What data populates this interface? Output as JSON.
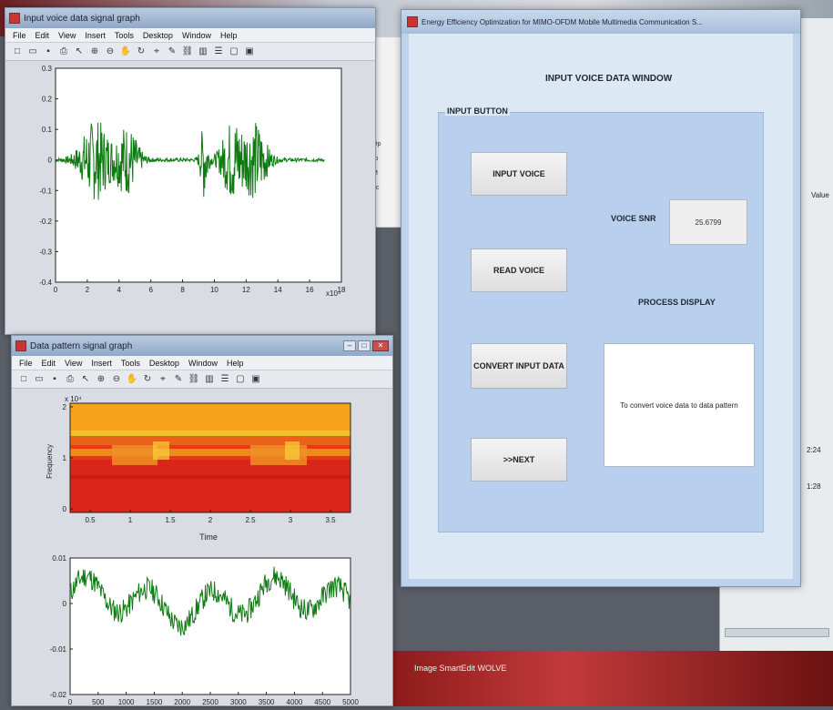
{
  "fig1": {
    "title": "Input voice data signal graph",
    "menu": [
      "File",
      "Edit",
      "View",
      "Insert",
      "Tools",
      "Desktop",
      "Window",
      "Help"
    ],
    "y_ticks": [
      "0.3",
      "0.2",
      "0.1",
      "0",
      "-0.1",
      "-0.2",
      "-0.3",
      "-0.4"
    ],
    "x_ticks": [
      "0",
      "2",
      "4",
      "6",
      "8",
      "10",
      "12",
      "14",
      "16",
      "18"
    ],
    "x_exp": "x10⁴"
  },
  "fig2": {
    "title": "Data pattern signal graph",
    "menu": [
      "File",
      "Edit",
      "View",
      "Insert",
      "Tools",
      "Desktop",
      "Window",
      "Help"
    ],
    "spec_exp": "x 10⁴",
    "spec_y_ticks": [
      "2",
      "1",
      "0"
    ],
    "spec_ylabel": "Frequency",
    "spec_x_ticks": [
      "0.5",
      "1",
      "1.5",
      "2",
      "2.5",
      "3",
      "3.5"
    ],
    "spec_xlabel": "Time",
    "sig_y_ticks": [
      "0.01",
      "0",
      "-0.01",
      "-0.02"
    ],
    "sig_x_ticks": [
      "0",
      "500",
      "1000",
      "1500",
      "2000",
      "2500",
      "3000",
      "3500",
      "4000",
      "4500",
      "5000"
    ]
  },
  "gui": {
    "title": "Energy Efficiency Optimization for MIMO-OFDM Mobile Multimedia Communication S...",
    "window_heading": "INPUT VOICE DATA WINDOW",
    "group_label": "INPUT BUTTON",
    "btn_input_voice": "INPUT VOICE",
    "btn_read_voice": "READ VOICE",
    "btn_convert": "CONVERT INPUT DATA",
    "btn_next": ">>NEXT",
    "snr_label": "VOICE SNR",
    "snr_value": "25.6799",
    "process_label": "PROCESS DISPLAY",
    "process_text": "To convert voice data to data pattern"
  },
  "background": {
    "right_col_label": "Value",
    "right_vals": [
      "2:24",
      "1:28"
    ],
    "bottom_text": "Image    SmartEdit    WOLVE"
  }
}
